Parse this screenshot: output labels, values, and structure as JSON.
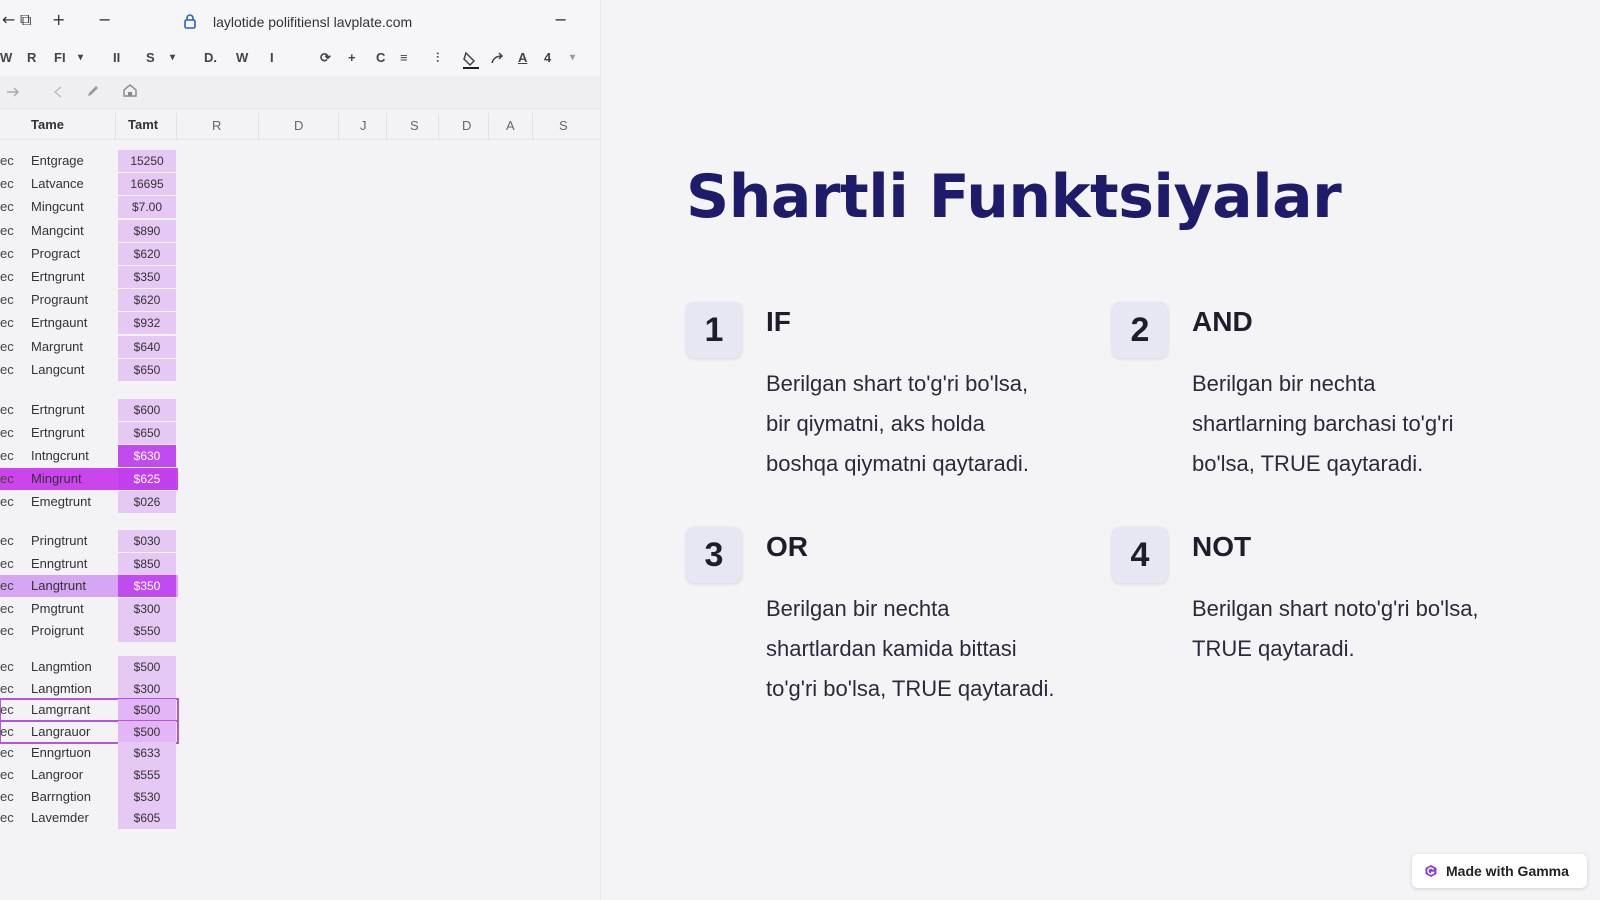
{
  "browser": {
    "url": "laylotide polifitiensl lavplate.com",
    "nav": [
      "←",
      "⧉",
      "+",
      "−"
    ],
    "minimize": "−"
  },
  "toolbar": {
    "items": [
      "W",
      "R",
      "FI",
      "▾",
      "II",
      "S",
      "▾",
      "D.",
      "W",
      "I",
      "⟳",
      "+",
      "C",
      "≡",
      "⫶",
      "A",
      "4",
      "▾"
    ]
  },
  "sheet": {
    "headers": {
      "name": "Tame",
      "amount": "Tamt"
    },
    "columns": [
      "R",
      "D",
      "J",
      "S",
      "D",
      "A",
      "S"
    ],
    "groups": [
      {
        "rows": [
          {
            "pre": "ec",
            "name": "Entgrage",
            "amount": "15250"
          },
          {
            "pre": "ec",
            "name": "Latvance",
            "amount": "16695"
          },
          {
            "pre": "ec",
            "name": "Mingcunt",
            "amount": "$7.00"
          },
          {
            "pre": "ec",
            "name": "Mangcint",
            "amount": "$890"
          },
          {
            "pre": "ec",
            "name": "Progract",
            "amount": "$620"
          },
          {
            "pre": "ec",
            "name": "Ertngrunt",
            "amount": "$350"
          },
          {
            "pre": "ec",
            "name": "Prograunt",
            "amount": "$620"
          },
          {
            "pre": "ec",
            "name": "Ertngaunt",
            "amount": "$932"
          },
          {
            "pre": "ec",
            "name": "Margrunt",
            "amount": "$640"
          },
          {
            "pre": "ec",
            "name": "Langcunt",
            "amount": "$650"
          }
        ]
      },
      {
        "rows": [
          {
            "pre": "ec",
            "name": "Ertngrunt",
            "amount": "$600"
          },
          {
            "pre": "ec",
            "name": "Ertngrunt",
            "amount": "$650"
          },
          {
            "pre": "ec",
            "name": "Intngcrunt",
            "amount": "$630",
            "highlight": "cell"
          },
          {
            "pre": "ec",
            "name": "Mingrunt",
            "amount": "$625",
            "highlight": "row"
          },
          {
            "pre": "ec",
            "name": "Emegtrunt",
            "amount": "$026"
          }
        ]
      },
      {
        "rows": [
          {
            "pre": "ec",
            "name": "Pringtrunt",
            "amount": "$030"
          },
          {
            "pre": "ec",
            "name": "Enngtrunt",
            "amount": "$850"
          },
          {
            "pre": "ec",
            "name": "Langtrunt",
            "amount": "$350",
            "highlight": "light-row"
          },
          {
            "pre": "ec",
            "name": "Pmgtrunt",
            "amount": "$300"
          },
          {
            "pre": "ec",
            "name": "Proigrunt",
            "amount": "$550"
          }
        ]
      },
      {
        "rows": [
          {
            "pre": "ec",
            "name": "Langmtion",
            "amount": "$500"
          },
          {
            "pre": "ec",
            "name": "Langmtion",
            "amount": "$300"
          },
          {
            "pre": "ec",
            "name": "Lamgrrant",
            "amount": "$500",
            "highlight": "outline"
          },
          {
            "pre": "ec",
            "name": "Langrauor",
            "amount": "$500",
            "highlight": "outline"
          },
          {
            "pre": "ec",
            "name": "Enngrtuon",
            "amount": "$633"
          },
          {
            "pre": "ec",
            "name": "Langroor",
            "amount": "$555"
          },
          {
            "pre": "ec",
            "name": "Barrngtion",
            "amount": "$530"
          },
          {
            "pre": "ec",
            "name": "Lavemder",
            "amount": "$605"
          }
        ]
      }
    ]
  },
  "slide": {
    "title": "Shartli Funktsiyalar",
    "cards": [
      {
        "number": "1",
        "name": "IF",
        "lines": [
          "Berilgan shart to'g'ri bo'lsa,",
          "bir qiymatni, aks holda",
          "boshqa qiymatni qaytaradi."
        ]
      },
      {
        "number": "2",
        "name": "AND",
        "lines": [
          "Berilgan bir nechta",
          "shartlarning barchasi to'g'ri",
          "bo'lsa, TRUE qaytaradi."
        ]
      },
      {
        "number": "3",
        "name": "OR",
        "lines": [
          "Berilgan bir nechta",
          "shartlardan kamida bittasi",
          "to'g'ri bo'lsa, TRUE qaytaradi."
        ]
      },
      {
        "number": "4",
        "name": "NOT",
        "lines": [
          "Berilgan shart noto'g'ri bo'lsa,",
          "TRUE qaytaradi."
        ]
      }
    ],
    "badge": "Made with Gamma"
  },
  "colors": {
    "title": "#1f1b6b",
    "cell_highlight": "#e6c8f5",
    "cell_strong": "#c04cf0",
    "number_box": "#e7e6f3"
  }
}
